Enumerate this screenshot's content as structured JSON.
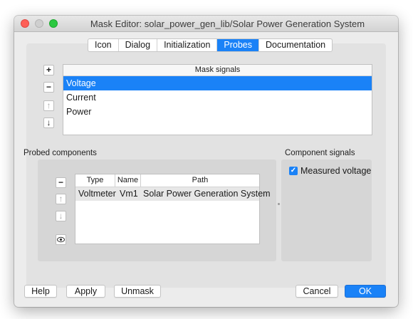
{
  "window": {
    "title": "Mask Editor: solar_power_gen_lib/Solar Power Generation System"
  },
  "tabs": [
    {
      "label": "Icon",
      "active": false
    },
    {
      "label": "Dialog",
      "active": false
    },
    {
      "label": "Initialization",
      "active": false
    },
    {
      "label": "Probes",
      "active": true
    },
    {
      "label": "Documentation",
      "active": false
    }
  ],
  "mask_signals": {
    "header": "Mask signals",
    "rows": [
      "Voltage",
      "Current",
      "Power"
    ],
    "selected": "Voltage",
    "buttons": {
      "add": "+",
      "remove": "−",
      "up": "↑",
      "down": "↓"
    }
  },
  "probed_components": {
    "label": "Probed components",
    "columns": [
      "Type",
      "Name",
      "Path"
    ],
    "rows": [
      {
        "type": "Voltmeter",
        "name": "Vm1",
        "path": "Solar Power Generation System"
      }
    ],
    "buttons": {
      "remove": "−",
      "up": "↑",
      "down": "↓",
      "view": "👁"
    }
  },
  "component_signals": {
    "label": "Component signals",
    "items": [
      {
        "label": "Measured voltage",
        "checked": true
      }
    ]
  },
  "footer": {
    "help": "Help",
    "apply": "Apply",
    "unmask": "Unmask",
    "cancel": "Cancel",
    "ok": "OK"
  },
  "colors": {
    "accent": "#1a82f7",
    "close": "#fe5f57",
    "maximize": "#2bc840"
  }
}
